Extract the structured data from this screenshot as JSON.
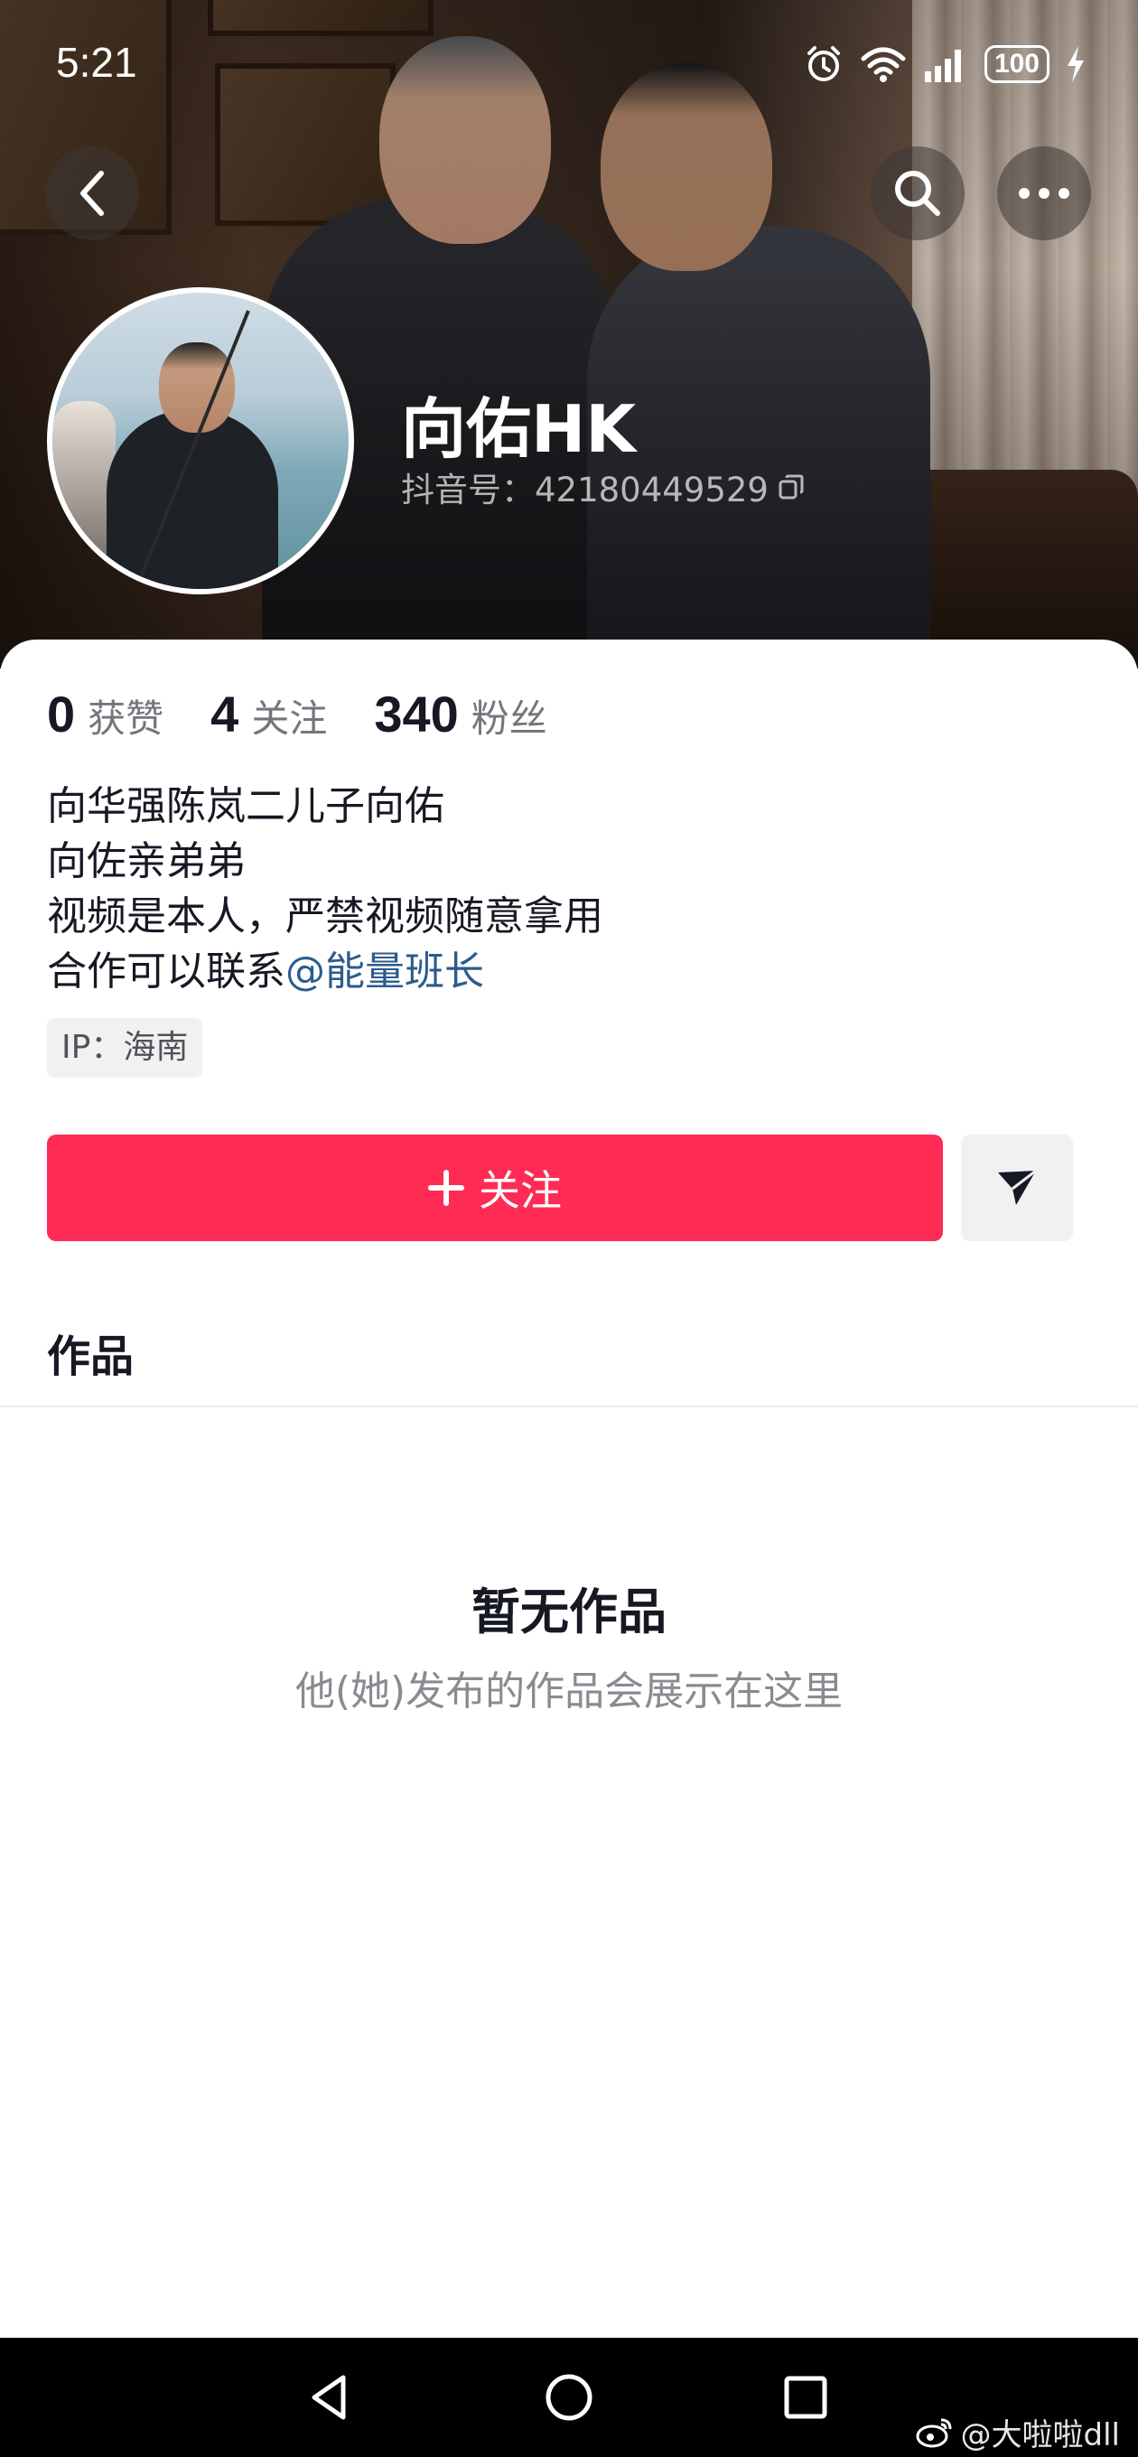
{
  "status_bar": {
    "time": "5:21",
    "battery": "100",
    "icons": [
      "alarm-icon",
      "wifi-icon",
      "signal-icon",
      "battery-icon",
      "charging-icon"
    ]
  },
  "top_nav": {
    "icons": [
      "back-arrow-icon",
      "search-icon",
      "more-icon"
    ]
  },
  "profile": {
    "name": "向佑HK",
    "douyin_id": "抖音号：42180449529",
    "copy_icon": "copy-icon"
  },
  "stats": [
    {
      "value": "0",
      "label": "获赞"
    },
    {
      "value": "4",
      "label": "关注"
    },
    {
      "value": "340",
      "label": "粉丝"
    }
  ],
  "bio": {
    "line1": "向华强陈岚二儿子向佑",
    "line2": "向佐亲弟弟",
    "line3": "视频是本人，严禁视频随意拿用",
    "line4_prefix": "合作可以联系",
    "line4_mention": "@能量班长"
  },
  "ip": "IP：海南",
  "actions": {
    "follow_label": "关注",
    "share_icon": "send-icon"
  },
  "tabs": {
    "works": "作品"
  },
  "empty_state": {
    "title": "暂无作品",
    "subtitle": "他(她)发布的作品会展示在这里"
  },
  "system_nav": {
    "icons": [
      "nav-back-icon",
      "nav-home-icon",
      "nav-recent-icon"
    ]
  },
  "watermark": "@大啦啦dll",
  "colors": {
    "accent": "#fe2c55",
    "mention": "#2b5b8c",
    "text_primary": "#161823",
    "text_secondary": "#75767c"
  }
}
